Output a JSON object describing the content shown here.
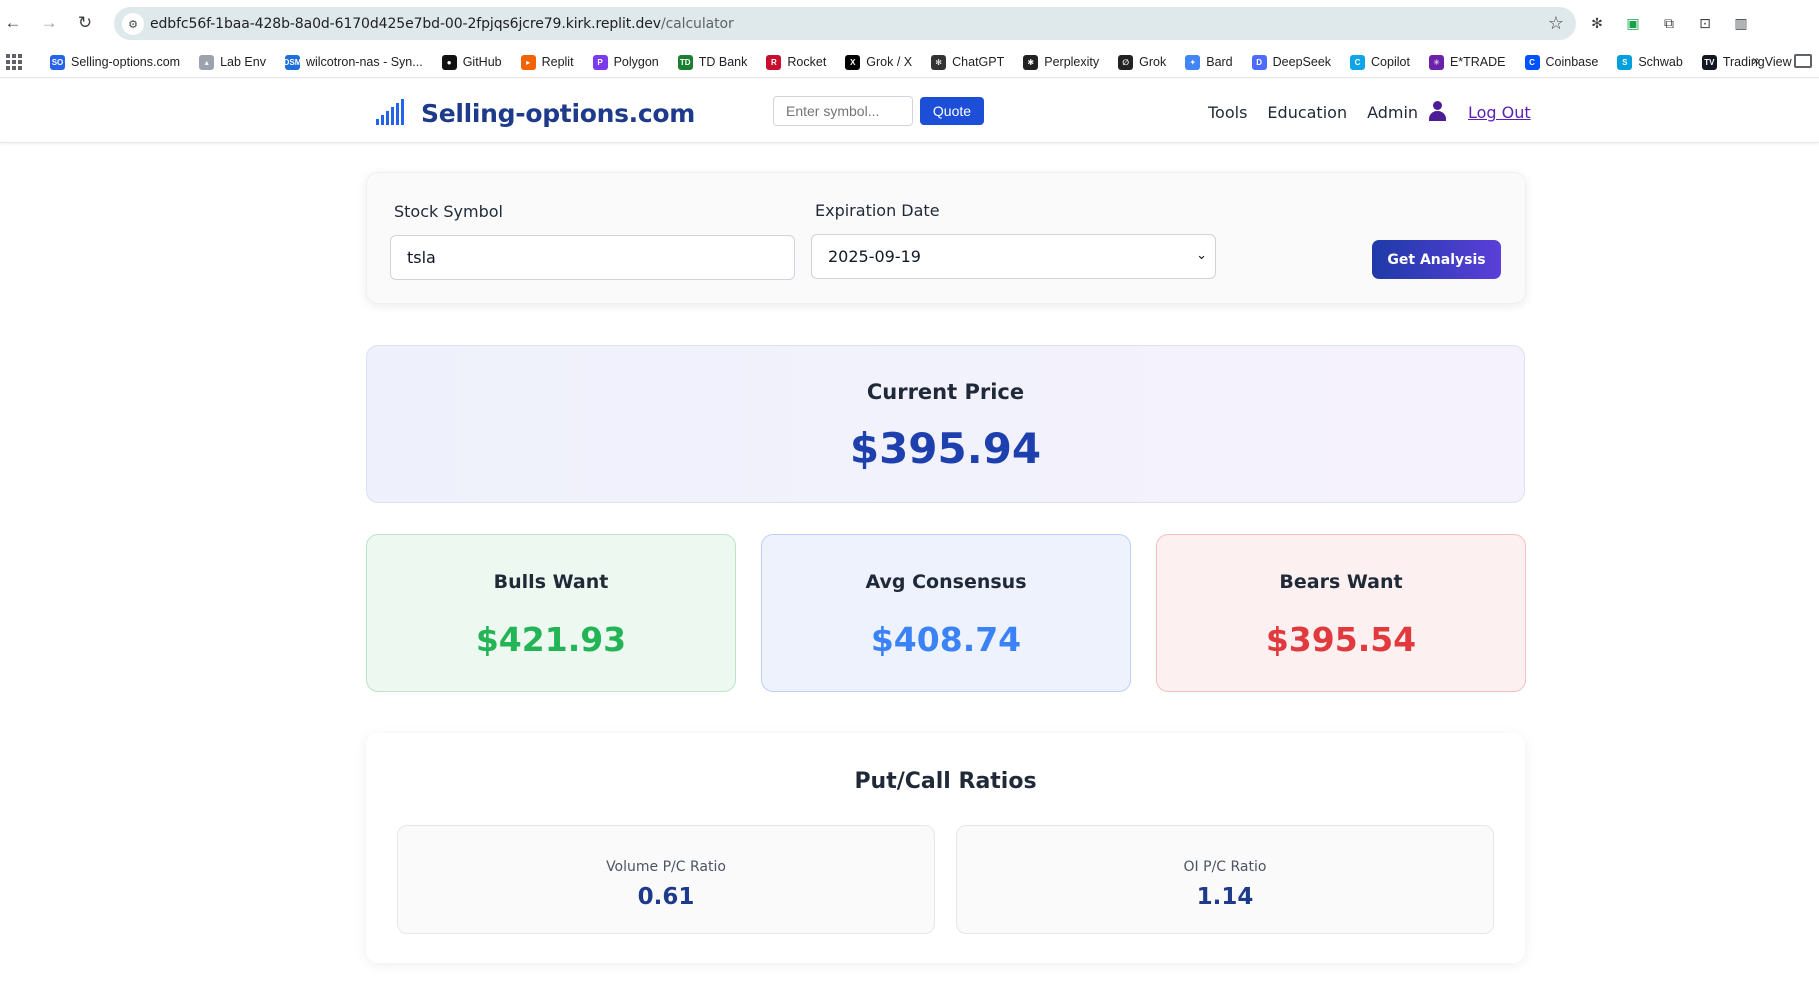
{
  "browser": {
    "url_host": "edbfc56f-1baa-428b-8a0d-6170d425e7bd-00-2fpjqs6jcre79.kirk.replit.dev",
    "url_path": "/calculator",
    "bookmarks": [
      {
        "label": "Selling-options.com",
        "icon": "so-icon",
        "color": "#2563eb",
        "glyph": "SO"
      },
      {
        "label": "Lab Env",
        "icon": "chart-icon",
        "color": "#9ca3af",
        "glyph": "▴"
      },
      {
        "label": "wilcotron-nas - Syn...",
        "icon": "dsm-icon",
        "color": "#1e6fd9",
        "glyph": "DSM"
      },
      {
        "label": "GitHub",
        "icon": "github-icon",
        "color": "#111111",
        "glyph": "●"
      },
      {
        "label": "Replit",
        "icon": "replit-icon",
        "color": "#f26207",
        "glyph": "▸"
      },
      {
        "label": "Polygon",
        "icon": "polygon-icon",
        "color": "#7c3aed",
        "glyph": "P"
      },
      {
        "label": "TD Bank",
        "icon": "td-icon",
        "color": "#1a7f2e",
        "glyph": "TD"
      },
      {
        "label": "Rocket",
        "icon": "rocket-icon",
        "color": "#c8102e",
        "glyph": "R"
      },
      {
        "label": "Grok / X",
        "icon": "x-icon",
        "color": "#000000",
        "glyph": "X"
      },
      {
        "label": "ChatGPT",
        "icon": "chatgpt-icon",
        "color": "#333333",
        "glyph": "✻"
      },
      {
        "label": "Perplexity",
        "icon": "perplexity-icon",
        "color": "#222222",
        "glyph": "✱"
      },
      {
        "label": "Grok",
        "icon": "grok-icon",
        "color": "#222222",
        "glyph": "∅"
      },
      {
        "label": "Bard",
        "icon": "bard-icon",
        "color": "#4285f4",
        "glyph": "✦"
      },
      {
        "label": "DeepSeek",
        "icon": "deepseek-icon",
        "color": "#4d6bfe",
        "glyph": "D"
      },
      {
        "label": "Copilot",
        "icon": "copilot-icon",
        "color": "#0ea5e9",
        "glyph": "C"
      },
      {
        "label": "E*TRADE",
        "icon": "etrade-icon",
        "color": "#6b21a8",
        "glyph": "✳"
      },
      {
        "label": "Coinbase",
        "icon": "coinbase-icon",
        "color": "#0052ff",
        "glyph": "C"
      },
      {
        "label": "Schwab",
        "icon": "schwab-icon",
        "color": "#00a0df",
        "glyph": "S"
      },
      {
        "label": "TradingView",
        "icon": "tradingview-icon",
        "color": "#131722",
        "glyph": "TV"
      }
    ]
  },
  "header": {
    "brand": "Selling-options.com",
    "symbol_placeholder": "Enter symbol...",
    "quote_label": "Quote",
    "nav": [
      "Tools",
      "Education",
      "Admin"
    ],
    "logout_label": "Log Out"
  },
  "form": {
    "symbol_label": "Stock Symbol",
    "symbol_value": "tsla",
    "expiration_label": "Expiration Date",
    "expiration_value": "2025-09-19",
    "button_label": "Get Analysis"
  },
  "price": {
    "label": "Current Price",
    "value": "$395.94"
  },
  "targets": {
    "bulls_label": "Bulls Want",
    "bulls_value": "$421.93",
    "avg_label": "Avg Consensus",
    "avg_value": "$408.74",
    "bears_label": "Bears Want",
    "bears_value": "$395.54"
  },
  "put_call": {
    "title": "Put/Call Ratios",
    "volume_label": "Volume P/C Ratio",
    "volume_value": "0.61",
    "oi_label": "OI P/C Ratio",
    "oi_value": "1.14"
  },
  "colors": {
    "brand": "#1e3a8a",
    "bulls": "#22b455",
    "avg": "#3b82f6",
    "bears": "#e0393e"
  }
}
